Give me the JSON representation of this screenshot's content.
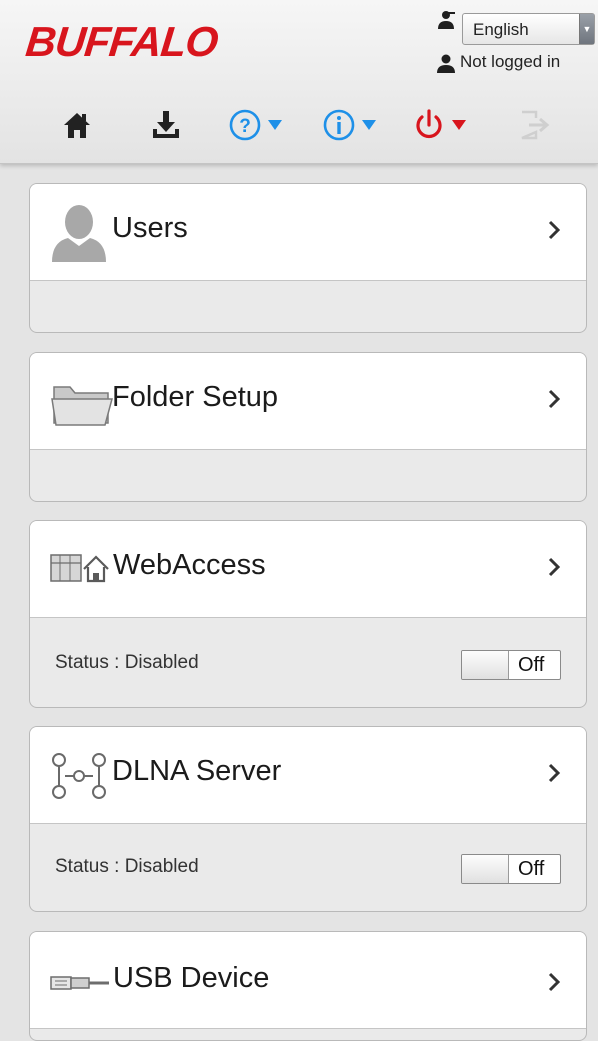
{
  "header": {
    "logo": "BUFFALO",
    "language": {
      "selected": "English"
    },
    "login_status": "Not logged in",
    "toolbar": {
      "home_icon": "home-icon",
      "download_icon": "download-icon",
      "help_icon": "help-icon",
      "info_icon": "info-icon",
      "power_icon": "power-icon",
      "logout_icon": "logout-icon"
    }
  },
  "colors": {
    "brand": "#d8151d",
    "accent_blue": "#1e90e8",
    "power_red": "#d8151d"
  },
  "cards": [
    {
      "title": "Users",
      "icon": "user-silhouette-icon"
    },
    {
      "title": "Folder Setup",
      "icon": "folder-icon"
    },
    {
      "title": "WebAccess",
      "icon": "webaccess-icon",
      "status": "Status : Disabled",
      "toggle": "Off"
    },
    {
      "title": "DLNA Server",
      "icon": "dlna-network-icon",
      "status": "Status : Disabled",
      "toggle": "Off"
    },
    {
      "title": "USB Device",
      "icon": "usb-cable-icon"
    }
  ]
}
